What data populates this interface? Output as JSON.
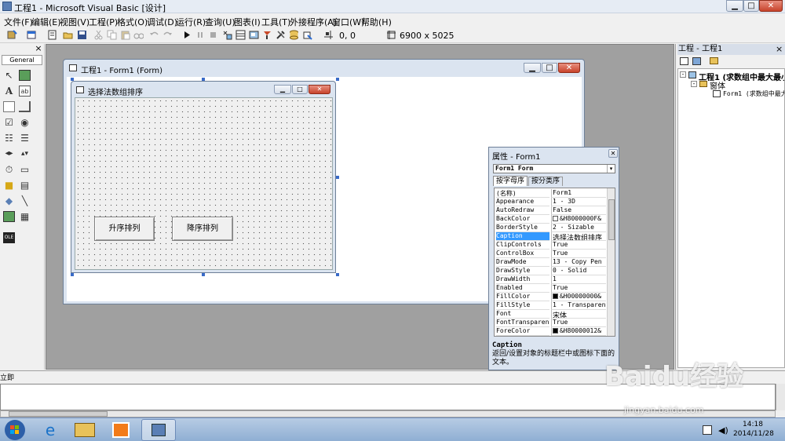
{
  "window": {
    "title": "工程1 - Microsoft Visual Basic [设计]",
    "min_glyph": "▁",
    "max_glyph": "□",
    "close_glyph": "✕"
  },
  "menu": [
    "文件(F)",
    "编辑(E)",
    "视图(V)",
    "工程(P)",
    "格式(O)",
    "调试(D)",
    "运行(R)",
    "查询(U)",
    "图表(I)",
    "工具(T)",
    "外接程序(A)",
    "窗口(W)",
    "帮助(H)"
  ],
  "toolbar": {
    "position": "0, 0",
    "size": "6900 x 5025"
  },
  "toolbox": {
    "close_glyph": "×",
    "tab": "General"
  },
  "project_window": {
    "title": "工程1 - Form1 (Form)"
  },
  "form": {
    "caption": "选择法数组排序",
    "buttons": {
      "asc": "升序排列",
      "desc": "降序排列"
    }
  },
  "properties": {
    "title": "属性 - Form1",
    "object_selector": "Form1 Form",
    "tabs": [
      "按字母序",
      "按分类序"
    ],
    "rows": [
      {
        "name": "(名称)",
        "value": "Form1"
      },
      {
        "name": "Appearance",
        "value": "1 - 3D"
      },
      {
        "name": "AutoRedraw",
        "value": "False"
      },
      {
        "name": "BackColor",
        "value": "&H8000000F&"
      },
      {
        "name": "BorderStyle",
        "value": "2 - Sizable"
      },
      {
        "name": "Caption",
        "value": "选择法数组排序"
      },
      {
        "name": "ClipControls",
        "value": "True"
      },
      {
        "name": "ControlBox",
        "value": "True"
      },
      {
        "name": "DrawMode",
        "value": "13 - Copy Pen"
      },
      {
        "name": "DrawStyle",
        "value": "0 - Solid"
      },
      {
        "name": "DrawWidth",
        "value": "1"
      },
      {
        "name": "Enabled",
        "value": "True"
      },
      {
        "name": "FillColor",
        "value": "&H00000000&"
      },
      {
        "name": "FillStyle",
        "value": "1 - Transparent"
      },
      {
        "name": "Font",
        "value": "宋体"
      },
      {
        "name": "FontTransparent",
        "value": "True"
      },
      {
        "name": "ForeColor",
        "value": "&H80000012&"
      }
    ],
    "selected_row": "Caption",
    "description_title": "Caption",
    "description_text": "返回/设置对象的标题栏中或图标下面的文本。"
  },
  "project_explorer": {
    "title": "工程 - 工程1",
    "tree": {
      "project": "工程1 (求数组中最大最小",
      "folder": "窗体",
      "form": "Form1 (求数组中最大"
    }
  },
  "immediate": {
    "title": "立即"
  },
  "taskbar": {
    "time": "14:18",
    "date": "2014/11/28"
  },
  "watermark": {
    "text": "Baidu经验",
    "url": "jingyan.baidu.com"
  }
}
